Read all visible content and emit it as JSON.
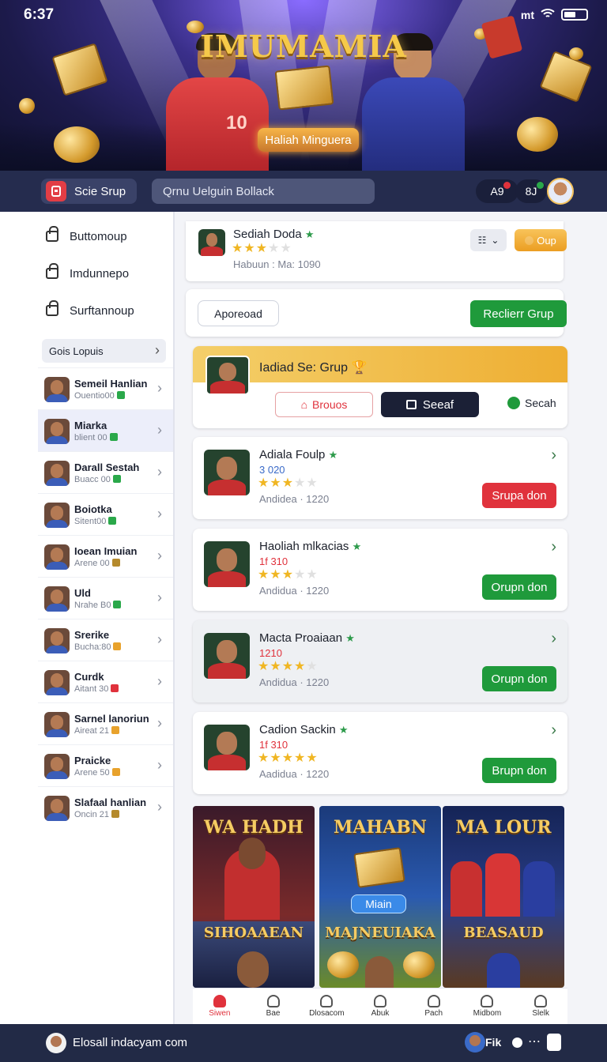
{
  "status_bar": {
    "time": "6:37",
    "carrier": "mt"
  },
  "hero": {
    "title": "IMUMAMIA",
    "badge": "Haliah Minguera"
  },
  "topbar": {
    "button_label": "Scie Srup",
    "search_text": "Qrnu Uelguin Bollack",
    "chip1": "A9",
    "chip2": "8J"
  },
  "sidebar": {
    "nav": [
      "Buttomoup",
      "Imdunnepo",
      "Surftannoup"
    ],
    "section": "Gois Lopuis",
    "users": [
      {
        "name": "Semeil Hanlian",
        "sub": "Ouentio00",
        "badge": "#2aa84a",
        "active": false
      },
      {
        "name": "Miarka",
        "sub": "blient 00",
        "badge": "#2aa84a",
        "active": true
      },
      {
        "name": "Darall Sestah",
        "sub": "Buacc 00",
        "badge": "#2aa84a",
        "active": false
      },
      {
        "name": "Boiotka",
        "sub": "Sitent00",
        "badge": "#2aa84a",
        "active": false
      },
      {
        "name": "Ioean Imuian",
        "sub": "Arene 00",
        "badge": "#b58a2c",
        "active": false
      },
      {
        "name": "Uld",
        "sub": "Nrahe B0",
        "badge": "#2aa84a",
        "active": false
      },
      {
        "name": "Srerike",
        "sub": "Bucha:80",
        "badge": "#e8a22c",
        "active": false
      },
      {
        "name": "Curdk",
        "sub": "Aitant 30",
        "badge": "#e0323c",
        "active": false
      },
      {
        "name": "Sarnel lanoriun",
        "sub": "Aireat 21",
        "badge": "#e8a22c",
        "active": false
      },
      {
        "name": "Praicke",
        "sub": "Arene 50",
        "badge": "#e8a22c",
        "active": false
      },
      {
        "name": "Slafaal hanlian",
        "sub": "Oncin 21",
        "badge": "#b58a2c",
        "active": false
      }
    ]
  },
  "profile": {
    "name": "Sediah Doda",
    "meta": "Habuun : Ma: 1090",
    "button": "Oup",
    "stars": 3
  },
  "actions": {
    "outline": "Aporeoad",
    "primary": "Reclierr Grup"
  },
  "featured": {
    "title": "Iadiad  Se: Grup",
    "tab1": "Brouos",
    "tab2": "Seeaf",
    "tab3": "Secah"
  },
  "groups": [
    {
      "name": "Adiala Foulp",
      "stat": "3 020",
      "meta": "Andidea · 1220",
      "button": "Srupa don",
      "btn_color": "red",
      "stars": 3,
      "highlight": false
    },
    {
      "name": "Haoliah mlkacias",
      "stat": "1f 310",
      "meta": "Andidua · 1220",
      "button": "Orupn don",
      "btn_color": "green",
      "stars": 3,
      "highlight": false
    },
    {
      "name": "Macta Proaiaan",
      "stat": "1210",
      "meta": "Andidua · 1220",
      "button": "Orupn don",
      "btn_color": "green",
      "stars": 4,
      "highlight": true
    },
    {
      "name": "Cadion Sackin",
      "stat": "1f 310",
      "meta": "Aadidua · 1220",
      "button": "Brupn don",
      "btn_color": "green",
      "stars": 5,
      "highlight": false
    }
  ],
  "tiles": [
    {
      "top": "WA HADH",
      "bottom": "SIHOAAEAN"
    },
    {
      "top": "MAHABN",
      "mid": "Miain",
      "bottom": "MAJNEUIAKA"
    },
    {
      "top": "MA LOUR",
      "bottom": "BEASAUD"
    }
  ],
  "tabbar": [
    "Siwen",
    "Bae",
    "Dlosacom",
    "Abuk",
    "Pach",
    "Midbom",
    "Slelk"
  ],
  "footer": {
    "text": "Elosall indacyam com",
    "right": "Fik"
  },
  "colors": {
    "accent_red": "#e0323c",
    "accent_green": "#1f9a3b",
    "nav_bg": "#252c4e",
    "gold": "#f0b623"
  }
}
